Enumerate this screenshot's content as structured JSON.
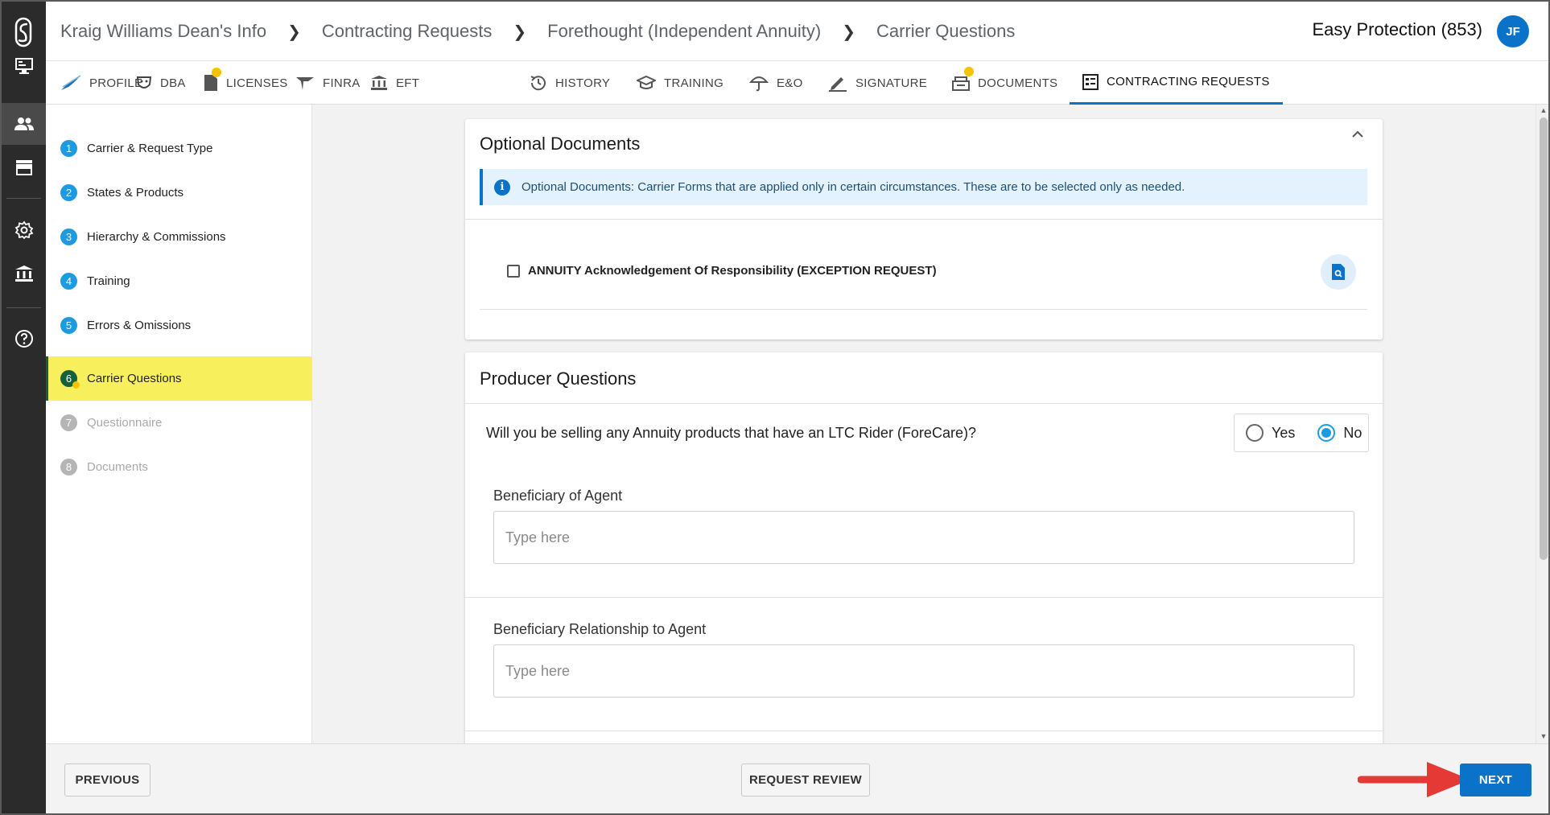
{
  "header": {
    "breadcrumbs": [
      "Kraig Williams Dean's Info",
      "Contracting Requests",
      "Forethought (Independent Annuity)",
      "Carrier Questions"
    ],
    "account": "Easy Protection (853)",
    "avatar_initials": "JF"
  },
  "rail": {
    "icons": [
      "logo-icon",
      "dashboard-icon",
      "people-icon",
      "store-icon",
      "settings-icon",
      "bank-icon",
      "help-icon"
    ],
    "active": "people-icon"
  },
  "tabs": [
    {
      "label": "PROFILE",
      "icon": "plane-icon"
    },
    {
      "label": "DBA",
      "icon": "mask-icon"
    },
    {
      "label": "LICENSES",
      "icon": "license-icon",
      "badge": true
    },
    {
      "label": "FINRA",
      "icon": "finra-icon"
    },
    {
      "label": "EFT",
      "icon": "bank-icon"
    },
    {
      "label": "HISTORY",
      "icon": "history-icon"
    },
    {
      "label": "TRAINING",
      "icon": "graduation-cap-icon"
    },
    {
      "label": "E&O",
      "icon": "umbrella-icon"
    },
    {
      "label": "SIGNATURE",
      "icon": "pen-icon"
    },
    {
      "label": "DOCUMENTS",
      "icon": "documents-icon",
      "badge": true
    },
    {
      "label": "CONTRACTING REQUESTS",
      "icon": "list-icon",
      "active": true
    }
  ],
  "steps": [
    {
      "num": "1",
      "label": "Carrier & Request Type",
      "state": "done"
    },
    {
      "num": "2",
      "label": "States & Products",
      "state": "done"
    },
    {
      "num": "3",
      "label": "Hierarchy & Commissions",
      "state": "done"
    },
    {
      "num": "4",
      "label": "Training",
      "state": "done"
    },
    {
      "num": "5",
      "label": "Errors & Omissions",
      "state": "done"
    },
    {
      "num": "6",
      "label": "Carrier Questions",
      "state": "active"
    },
    {
      "num": "7",
      "label": "Questionnaire",
      "state": "disabled"
    },
    {
      "num": "8",
      "label": "Documents",
      "state": "disabled"
    }
  ],
  "optional_documents": {
    "title": "Optional Documents",
    "info": "Optional Documents: Carrier Forms that are applied only in certain circumstances. These are to be selected only as needed.",
    "items": [
      {
        "label": "ANNUITY Acknowledgement Of Responsibility (EXCEPTION REQUEST)",
        "checked": false
      }
    ]
  },
  "producer_questions": {
    "title": "Producer Questions",
    "question": "Will you be selling any Annuity products that have an LTC Rider (ForeCare)?",
    "yes_label": "Yes",
    "no_label": "No",
    "selected": "No",
    "fields": [
      {
        "label": "Beneficiary of Agent",
        "placeholder": "Type here",
        "value": ""
      },
      {
        "label": "Beneficiary Relationship to Agent",
        "placeholder": "Type here",
        "value": ""
      }
    ]
  },
  "footer": {
    "previous": "PREVIOUS",
    "request_review": "REQUEST REVIEW",
    "next": "NEXT"
  },
  "colors": {
    "primary": "#0a73c9",
    "active_step_bg": "#f7ef5c",
    "active_step_marker": "#16603a",
    "badge": "#f5c400",
    "annotation_arrow": "#e53935"
  }
}
